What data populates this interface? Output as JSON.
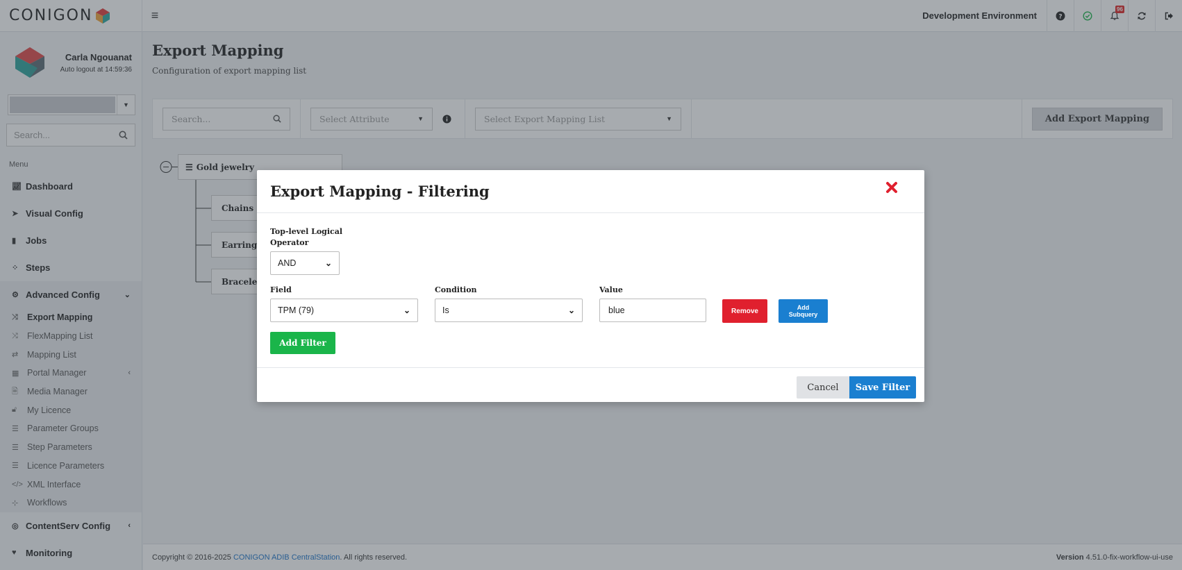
{
  "topbar": {
    "logo_text": "CONIGON",
    "environment": "Development Environment",
    "notification_count": "96"
  },
  "sidebar": {
    "user_name": "Carla Ngouanat",
    "auto_logout": "Auto logout at 14:59:36",
    "search_placeholder": "Search...",
    "menu_caption": "Menu",
    "main_items": [
      {
        "label": "Dashboard",
        "icon": "chart-icon"
      },
      {
        "label": "Visual Config",
        "icon": "cursor-icon"
      },
      {
        "label": "Jobs",
        "icon": "jobs-icon"
      },
      {
        "label": "Steps",
        "icon": "paw-icon"
      }
    ],
    "advanced": {
      "label": "Advanced Config",
      "items": [
        {
          "label": "Export Mapping",
          "icon": "shuffle-icon",
          "active": true
        },
        {
          "label": "FlexMapping List",
          "icon": "shuffle-icon"
        },
        {
          "label": "Mapping List",
          "icon": "exchange-icon"
        },
        {
          "label": "Portal Manager",
          "icon": "grid-icon"
        },
        {
          "label": "Media Manager",
          "icon": "file-icon"
        },
        {
          "label": "My Licence",
          "icon": "unlock-icon"
        },
        {
          "label": "Parameter Groups",
          "icon": "sliders-icon"
        },
        {
          "label": "Step Parameters",
          "icon": "sliders-icon"
        },
        {
          "label": "Licence Parameters",
          "icon": "sliders-icon"
        },
        {
          "label": "XML Interface",
          "icon": "code-icon"
        },
        {
          "label": "Workflows",
          "icon": "sitemap-icon"
        }
      ]
    },
    "contentserv": "ContentServ Config",
    "monitoring": "Monitoring"
  },
  "main": {
    "title": "Export Mapping",
    "subtitle": "Configuration of export mapping list",
    "toolbar": {
      "search_placeholder": "Search...",
      "attribute_placeholder": "Select Attribute",
      "mapping_list_placeholder": "Select Export Mapping List",
      "add_button": "Add Export Mapping"
    },
    "tree": {
      "root": "Gold jewelry",
      "children": [
        "Chains",
        "Earrings",
        "Bracelet"
      ]
    }
  },
  "modal": {
    "title": "Export Mapping - Filtering",
    "operator_label_line1": "Top-level Logical",
    "operator_label_line2": "Operator",
    "operator_value": "AND",
    "field_label": "Field",
    "field_value": "TPM (79)",
    "condition_label": "Condition",
    "condition_value": "Is",
    "value_label": "Value",
    "value_value": "blue",
    "remove_button": "Remove",
    "add_subquery_line1": "Add",
    "add_subquery_line2": "Subquery",
    "add_filter_button": "Add Filter",
    "cancel_button": "Cancel",
    "save_button": "Save Filter"
  },
  "footer": {
    "copyright_prefix": "Copyright © 2016-2025",
    "copyright_link": "CONIGON ADIB CentralStation",
    "copyright_suffix": ". All rights reserved.",
    "version_label": "Version",
    "version_value": "4.51.0-fix-workflow-ui-use"
  },
  "colors": {
    "primary": "#1a7fd0",
    "danger": "#e0202e",
    "success": "#1ab54a",
    "overlay": "#3c444e"
  }
}
